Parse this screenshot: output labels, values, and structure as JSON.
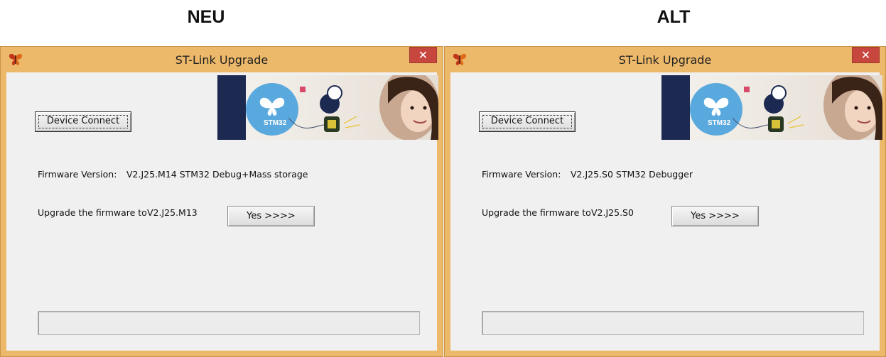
{
  "headings": {
    "left": "NEU",
    "right": "ALT"
  },
  "windows": [
    {
      "title": "ST-Link Upgrade",
      "close_label": "✕",
      "device_connect_label": "Device Connect",
      "banner": {
        "logo_text": "STM32"
      },
      "firmware_label": "Firmware Version:",
      "firmware_value": "V2.J25.M14 STM32 Debug+Mass storage",
      "upgrade_label": "Upgrade the firmware to",
      "upgrade_version": "V2.J25.M13",
      "yes_label": "Yes >>>>",
      "progress": 0
    },
    {
      "title": "ST-Link Upgrade",
      "close_label": "✕",
      "device_connect_label": "Device Connect",
      "banner": {
        "logo_text": "STM32"
      },
      "firmware_label": "Firmware Version:",
      "firmware_value": "V2.J25.S0 STM32 Debugger",
      "upgrade_label": "Upgrade the firmware to",
      "upgrade_version": "V2.J25.S0",
      "yes_label": "Yes >>>>",
      "progress": 0
    }
  ],
  "colors": {
    "window_frame": "#ecb86a",
    "client_bg": "#f0f0f0",
    "close_button": "#c7463d",
    "banner_navy": "#1c2a52",
    "banner_blue": "#5aa9de"
  },
  "icons": {
    "app_icon": "butterfly-icon",
    "close": "close-icon"
  }
}
